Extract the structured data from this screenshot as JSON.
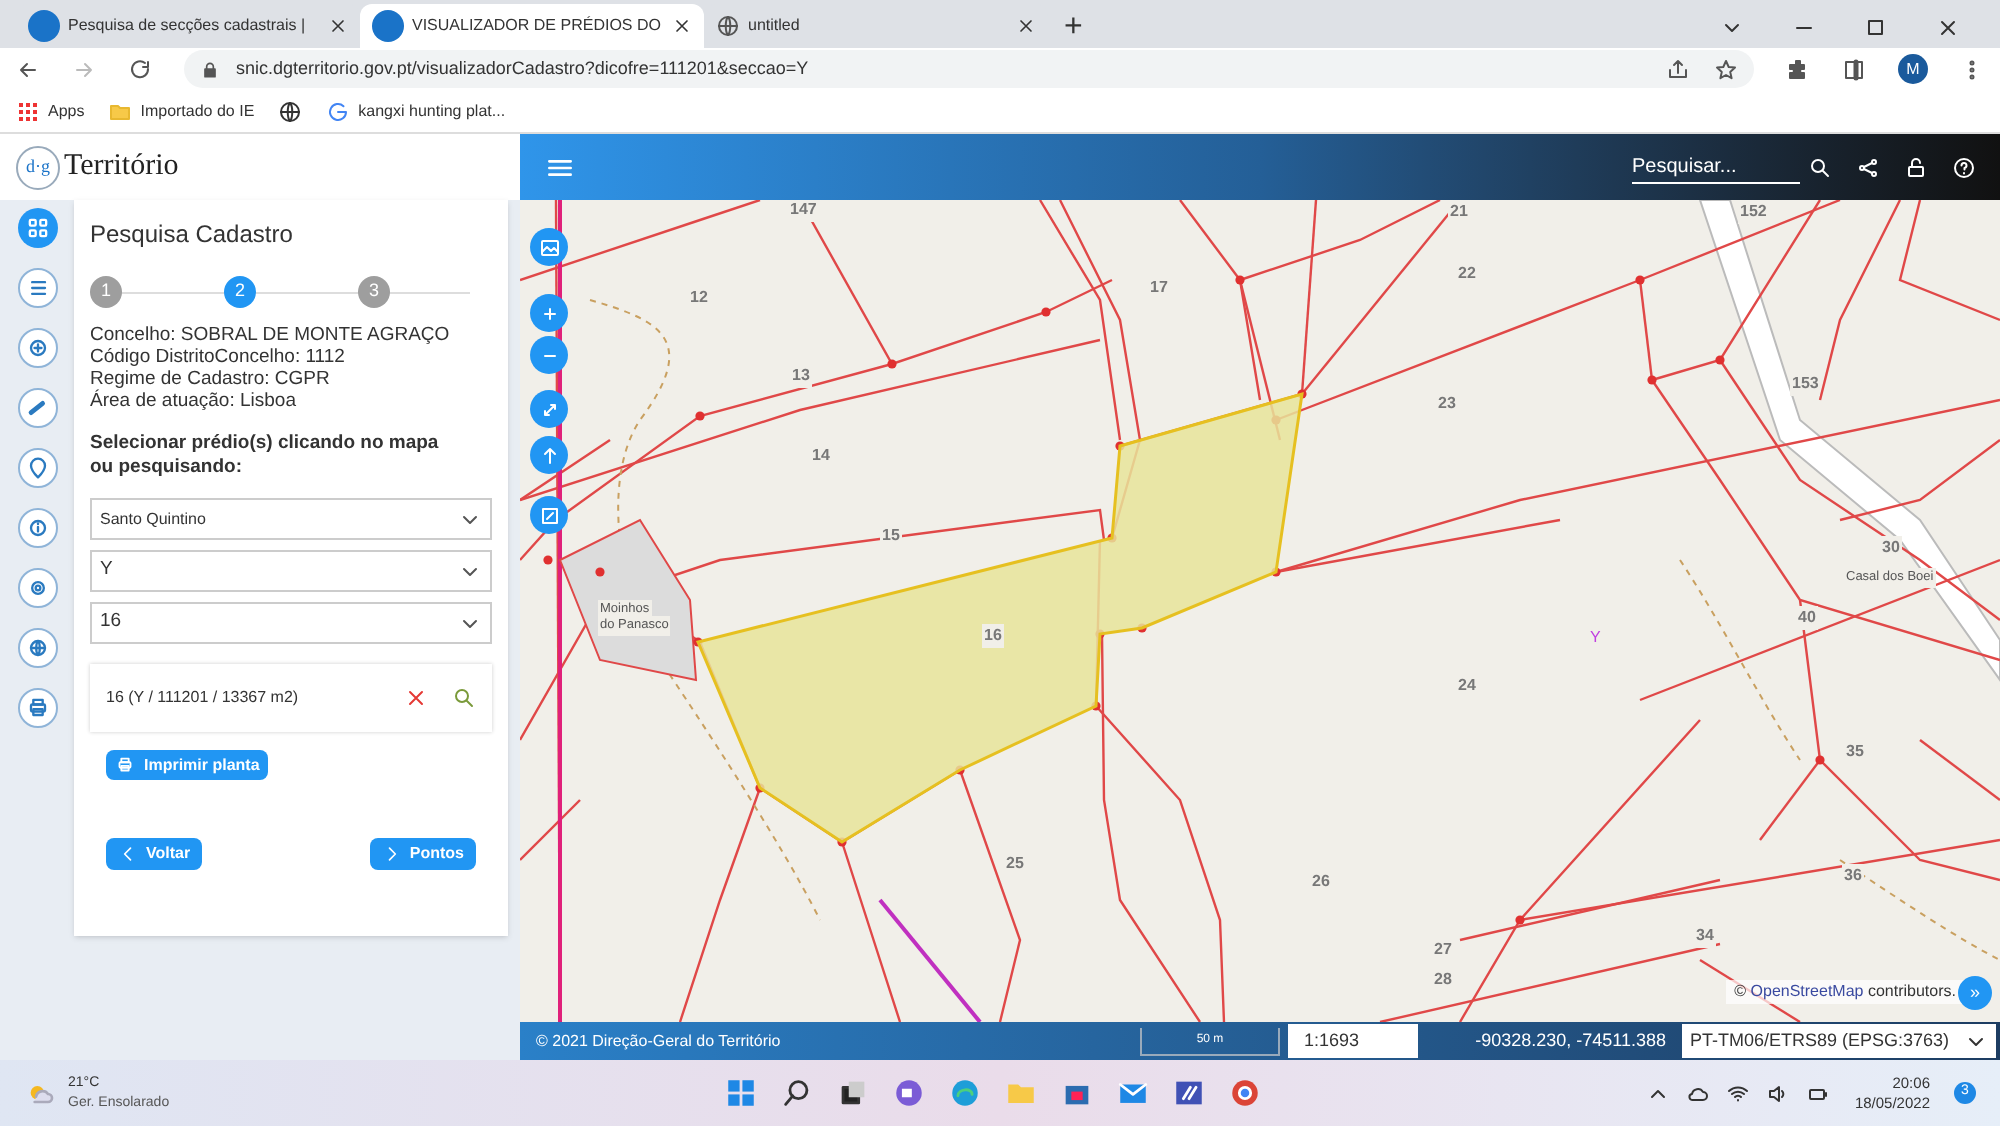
{
  "browser": {
    "tabs": [
      {
        "title": "Pesquisa de secções cadastrais | ",
        "selected": false
      },
      {
        "title": "VISUALIZADOR DE PRÉDIOS DO",
        "selected": true
      },
      {
        "title": "untitled",
        "selected": false
      }
    ],
    "new_tab": "+",
    "url": "snic.dgterritorio.gov.pt/visualizadorCadastro?dicofre=111201&seccao=Y",
    "profile": "M",
    "bookmarks": [
      {
        "kind": "apps",
        "label": "Apps"
      },
      {
        "kind": "folder",
        "label": "Importado do IE"
      },
      {
        "kind": "globe"
      },
      {
        "kind": "google",
        "label": "kangxi hunting plat..."
      }
    ]
  },
  "app": {
    "logo_prefix": "d·g",
    "logo": "Território",
    "search_placeholder": "Pesquisar...",
    "side_tools": [
      {
        "kind": "grid",
        "selected": true
      },
      {
        "kind": "list",
        "selected": false
      },
      {
        "kind": "plus",
        "selected": false
      },
      {
        "kind": "ruler",
        "selected": false
      },
      {
        "kind": "pin",
        "selected": false
      },
      {
        "kind": "info",
        "selected": false
      },
      {
        "kind": "target",
        "selected": false
      },
      {
        "kind": "globe",
        "selected": false
      },
      {
        "kind": "print",
        "selected": false
      }
    ],
    "panel": {
      "title": "Pesquisa Cadastro",
      "steps": [
        {
          "label": "1",
          "selected": false
        },
        {
          "label": "2",
          "selected": true
        },
        {
          "label": "3",
          "selected": false
        }
      ],
      "info": [
        "Concelho: SOBRAL DE MONTE AGRAÇO",
        "Código DistritoConcelho: 1112",
        "Regime de Cadastro: CGPR",
        "Área de atuação: Lisboa"
      ],
      "prompt": "Selecionar prédio(s) clicando no mapa ou pesquisando:",
      "selects": [
        "Santo Quintino",
        "Y",
        "16"
      ],
      "result": "16 (Y / 111201 / 13367 m2)",
      "print_button": "Imprimir planta",
      "back_button": "Voltar",
      "next_button": "Pontos"
    },
    "map": {
      "labels": [
        "147",
        "21",
        "152",
        "12",
        "17",
        "22",
        "13",
        "153",
        "23",
        "14",
        "15",
        "Moinhos",
        "do Panasco",
        "16",
        "Y",
        "40",
        "30",
        "Casal dos Boei",
        "24",
        "35",
        "25",
        "26",
        "36",
        "34",
        "27",
        "28"
      ],
      "attribution": {
        "prefix": "©",
        "link": "OpenStreetMap",
        "suffix": "contributors."
      },
      "expand": "»"
    },
    "status_bar": {
      "copyright": "© 2021 Direção-Geral do Território",
      "scale": "50 m",
      "scale_ratio": "1:1693",
      "coordinates": "-90328.230, -74511.388",
      "projection": "PT-TM06/ETRS89 (EPSG:3763)"
    }
  },
  "taskbar": {
    "temperature": "21°C",
    "weather": "Ger. Ensolarado",
    "time": "20:06",
    "date": "18/05/2022",
    "notifications": "3"
  }
}
